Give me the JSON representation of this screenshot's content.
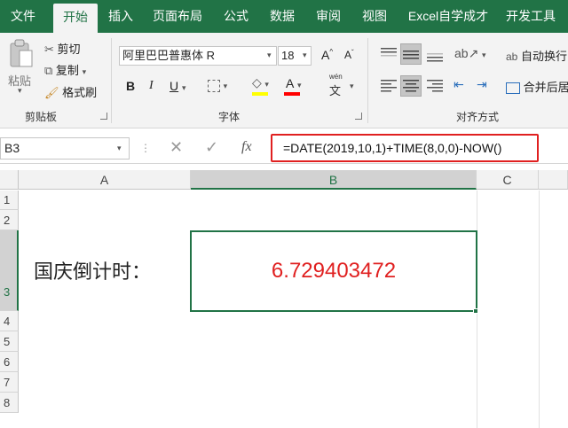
{
  "tabs": [
    {
      "label": "文件",
      "active": false
    },
    {
      "label": "开始",
      "active": true
    },
    {
      "label": "插入",
      "active": false
    },
    {
      "label": "页面布局",
      "active": false
    },
    {
      "label": "公式",
      "active": false
    },
    {
      "label": "数据",
      "active": false
    },
    {
      "label": "审阅",
      "active": false
    },
    {
      "label": "视图",
      "active": false
    },
    {
      "label": "Excel自学成才",
      "active": false
    },
    {
      "label": "开发工具",
      "active": false
    }
  ],
  "clipboard": {
    "paste": "粘贴",
    "cut": "剪切",
    "copy": "复制",
    "format_painter": "格式刷",
    "label": "剪贴板"
  },
  "font": {
    "name": "阿里巴巴普惠体 R",
    "size": "18",
    "label": "字体",
    "bold": "B",
    "italic": "I",
    "underline": "U",
    "grow": "A",
    "shrink": "A",
    "phonetic_top": "wén",
    "phonetic_char": "文",
    "font_color_glyph": "A"
  },
  "alignment": {
    "wrap": "自动换行",
    "merge": "合并后居",
    "label": "对齐方式"
  },
  "formula_bar": {
    "cell_ref": "B3",
    "fx": "fx",
    "formula": "=DATE(2019,10,1)+TIME(8,0,0)-NOW()"
  },
  "sheet": {
    "columns": [
      "A",
      "B",
      "C"
    ],
    "rows": [
      "1",
      "2",
      "3",
      "4",
      "5",
      "6",
      "7",
      "8"
    ],
    "a3": "国庆倒计时：",
    "b3": "6.729403472"
  },
  "colors": {
    "accent": "#217346",
    "highlight_bar": "#ffff00",
    "font_color_bar": "#ff0000",
    "value_red": "#e02020"
  }
}
